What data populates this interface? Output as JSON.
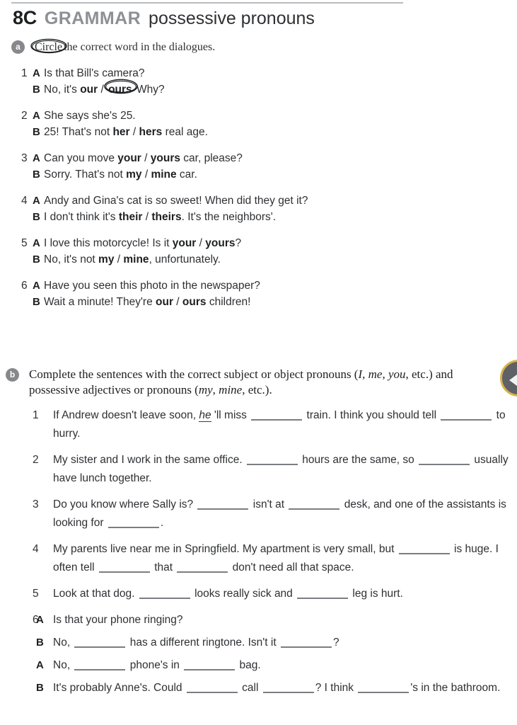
{
  "header": {
    "code": "8C",
    "section": "GRAMMAR",
    "topic": "possessive pronouns"
  },
  "exercise_a": {
    "badge": "a",
    "instruction_circle_word": "Circle",
    "instruction_rest": "the correct word in the dialogues.",
    "items": [
      {
        "number": "1",
        "lines": [
          {
            "speaker": "A",
            "parts": [
              {
                "t": "Is that Bill's camera?",
                "b": false
              }
            ]
          },
          {
            "speaker": "B",
            "parts": [
              {
                "t": "No, it's ",
                "b": false
              },
              {
                "t": "our",
                "b": true
              },
              {
                "t": " / ",
                "b": false
              },
              {
                "t": "ours",
                "b": true,
                "circled": true
              },
              {
                "t": " Why?",
                "b": false
              }
            ]
          }
        ]
      },
      {
        "number": "2",
        "lines": [
          {
            "speaker": "A",
            "parts": [
              {
                "t": "She says she's 25.",
                "b": false
              }
            ]
          },
          {
            "speaker": "B",
            "parts": [
              {
                "t": "25! That's not ",
                "b": false
              },
              {
                "t": "her",
                "b": true
              },
              {
                "t": " / ",
                "b": false
              },
              {
                "t": "hers",
                "b": true
              },
              {
                "t": " real age.",
                "b": false
              }
            ]
          }
        ]
      },
      {
        "number": "3",
        "lines": [
          {
            "speaker": "A",
            "parts": [
              {
                "t": "Can you move ",
                "b": false
              },
              {
                "t": "your",
                "b": true
              },
              {
                "t": " / ",
                "b": false
              },
              {
                "t": "yours",
                "b": true
              },
              {
                "t": " car, please?",
                "b": false
              }
            ]
          },
          {
            "speaker": "B",
            "parts": [
              {
                "t": "Sorry. That's not ",
                "b": false
              },
              {
                "t": "my",
                "b": true
              },
              {
                "t": " / ",
                "b": false
              },
              {
                "t": "mine",
                "b": true
              },
              {
                "t": " car.",
                "b": false
              }
            ]
          }
        ]
      },
      {
        "number": "4",
        "lines": [
          {
            "speaker": "A",
            "parts": [
              {
                "t": "Andy and Gina's cat is so sweet! When did they get it?",
                "b": false
              }
            ]
          },
          {
            "speaker": "B",
            "parts": [
              {
                "t": "I don't think it's ",
                "b": false
              },
              {
                "t": "their",
                "b": true
              },
              {
                "t": " / ",
                "b": false
              },
              {
                "t": "theirs",
                "b": true
              },
              {
                "t": ". It's the neighbors'.",
                "b": false
              }
            ]
          }
        ]
      },
      {
        "number": "5",
        "lines": [
          {
            "speaker": "A",
            "parts": [
              {
                "t": "I love this motorcycle! Is it ",
                "b": false
              },
              {
                "t": "your",
                "b": true
              },
              {
                "t": " / ",
                "b": false
              },
              {
                "t": "yours",
                "b": true
              },
              {
                "t": "?",
                "b": false
              }
            ]
          },
          {
            "speaker": "B",
            "parts": [
              {
                "t": "No, it's not ",
                "b": false
              },
              {
                "t": "my",
                "b": true
              },
              {
                "t": " / ",
                "b": false
              },
              {
                "t": "mine",
                "b": true
              },
              {
                "t": ", unfortunately.",
                "b": false
              }
            ]
          }
        ]
      },
      {
        "number": "6",
        "lines": [
          {
            "speaker": "A",
            "parts": [
              {
                "t": "Have you seen this photo in the newspaper?",
                "b": false
              }
            ]
          },
          {
            "speaker": "B",
            "parts": [
              {
                "t": "Wait a minute! They're ",
                "b": false
              },
              {
                "t": "our",
                "b": true
              },
              {
                "t": " / ",
                "b": false
              },
              {
                "t": "ours",
                "b": true
              },
              {
                "t": " children!",
                "b": false
              }
            ]
          }
        ]
      }
    ]
  },
  "exercise_b": {
    "badge": "b",
    "instruction_segments": [
      {
        "t": "Complete the sentences with the correct subject or object pronouns (",
        "i": false
      },
      {
        "t": "I",
        "i": true
      },
      {
        "t": ", ",
        "i": false
      },
      {
        "t": "me",
        "i": true
      },
      {
        "t": ", ",
        "i": false
      },
      {
        "t": "you",
        "i": true
      },
      {
        "t": ", etc.) and possessive adjectives or pronouns (",
        "i": false
      },
      {
        "t": "my",
        "i": true
      },
      {
        "t": ", ",
        "i": false
      },
      {
        "t": "mine",
        "i": true
      },
      {
        "t": ", etc.).",
        "i": false
      }
    ],
    "items": [
      {
        "number": "1",
        "type": "sentence",
        "segments": [
          {
            "k": "t",
            "t": "If Andrew doesn't leave soon, "
          },
          {
            "k": "example",
            "t": "he"
          },
          {
            "k": "t",
            "t": " 'll miss "
          },
          {
            "k": "blank"
          },
          {
            "k": "t",
            "t": " train. I think you should tell "
          },
          {
            "k": "blank"
          },
          {
            "k": "t",
            "t": " to hurry."
          }
        ]
      },
      {
        "number": "2",
        "type": "sentence",
        "segments": [
          {
            "k": "t",
            "t": "My sister and I work in the same office. "
          },
          {
            "k": "blank"
          },
          {
            "k": "t",
            "t": " hours are the same, so "
          },
          {
            "k": "blank"
          },
          {
            "k": "t",
            "t": " usually have lunch together."
          }
        ]
      },
      {
        "number": "3",
        "type": "sentence",
        "segments": [
          {
            "k": "t",
            "t": "Do you know where Sally is? "
          },
          {
            "k": "blank"
          },
          {
            "k": "t",
            "t": " isn't at "
          },
          {
            "k": "blank"
          },
          {
            "k": "t",
            "t": " desk, and one of the assistants is looking for "
          },
          {
            "k": "blank"
          },
          {
            "k": "t",
            "t": "."
          }
        ]
      },
      {
        "number": "4",
        "type": "sentence",
        "segments": [
          {
            "k": "t",
            "t": "My parents live near me in Springfield. My apartment is very small, but "
          },
          {
            "k": "blank"
          },
          {
            "k": "t",
            "t": " is huge. I often tell "
          },
          {
            "k": "blank"
          },
          {
            "k": "t",
            "t": " that "
          },
          {
            "k": "blank"
          },
          {
            "k": "t",
            "t": " don't need all that space."
          }
        ]
      },
      {
        "number": "5",
        "type": "sentence",
        "segments": [
          {
            "k": "t",
            "t": "Look at that dog. "
          },
          {
            "k": "blank"
          },
          {
            "k": "t",
            "t": " looks really sick and "
          },
          {
            "k": "blank"
          },
          {
            "k": "t",
            "t": " leg is hurt."
          }
        ]
      },
      {
        "number": "6",
        "type": "dialogue",
        "lines": [
          {
            "speaker": "A",
            "segments": [
              {
                "k": "t",
                "t": "Is that your phone ringing?"
              }
            ]
          },
          {
            "speaker": "B",
            "segments": [
              {
                "k": "t",
                "t": "No, "
              },
              {
                "k": "blank"
              },
              {
                "k": "t",
                "t": " has a different ringtone. Isn't it "
              },
              {
                "k": "blank"
              },
              {
                "k": "t",
                "t": "?"
              }
            ]
          },
          {
            "speaker": "A",
            "segments": [
              {
                "k": "t",
                "t": "No, "
              },
              {
                "k": "blank"
              },
              {
                "k": "t",
                "t": " phone's in "
              },
              {
                "k": "blank"
              },
              {
                "k": "t",
                "t": " bag."
              }
            ]
          },
          {
            "speaker": "B",
            "segments": [
              {
                "k": "t",
                "t": "It's probably Anne's. Could "
              },
              {
                "k": "blank"
              },
              {
                "k": "t",
                "t": " call "
              },
              {
                "k": "blank"
              },
              {
                "k": "t",
                "t": "? I think "
              },
              {
                "k": "blank"
              },
              {
                "k": "t",
                "t": "'s in the bathroom."
              }
            ]
          }
        ]
      }
    ]
  },
  "audio_badge": {
    "icon": "play-triangle-icon"
  },
  "colors": {
    "text": "#2e3033",
    "heading_dark": "#1d1f21",
    "heading_gray": "#8d9094",
    "badge_gray": "#86888c",
    "rule_gray": "#b9bbbe",
    "blank_gray": "#7a7d81",
    "audio_ring": "#d8b24a",
    "audio_fill": "#5e6165"
  }
}
